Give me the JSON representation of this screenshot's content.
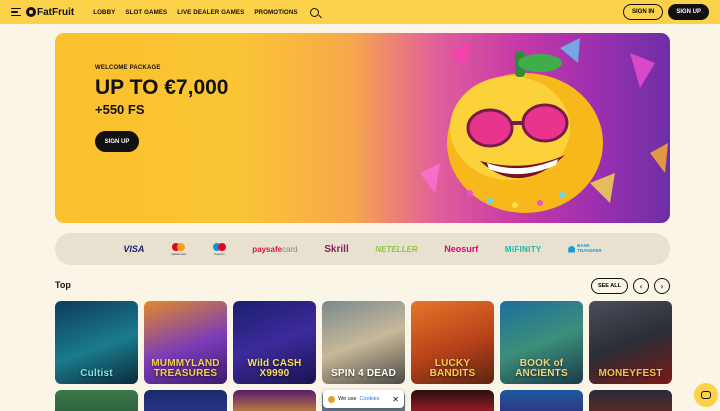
{
  "header": {
    "brand": "FatFruit",
    "nav": [
      "LOBBY",
      "SLOT GAMES",
      "LIVE DEALER GAMES",
      "PROMOTIONS"
    ],
    "sign_in": "SIGN IN",
    "sign_up": "SIGN UP"
  },
  "hero": {
    "eyebrow": "WELCOME PACKAGE",
    "title": "UP TO €7,000",
    "subtitle": "+550 FS",
    "button": "SIGN UP"
  },
  "payments": {
    "visa": "VISA",
    "mastercard": "mastercard",
    "maestro": "maestro",
    "paysafe": "paysafe",
    "paysafe_card": "card",
    "skrill": "Skrill",
    "neteller": "NETELLER",
    "neosurf": "Neosurf",
    "mifinity": "MiFINITY",
    "bank_line1": "BANK",
    "bank_line2": "TRANSFER"
  },
  "top": {
    "title": "Top",
    "see_all": "SEE ALL",
    "prev": "‹",
    "next": "›",
    "games": [
      {
        "title": "Cultist",
        "bg": "linear-gradient(160deg,#0d3b5c,#1a7b8c 55%,#0b2a3d)",
        "color": "#7be6e0"
      },
      {
        "title": "MUMMYLAND TREASURES",
        "bg": "linear-gradient(160deg,#e08a2a,#7b3cb8 55%,#3b1a6e)",
        "color": "#f7d04a"
      },
      {
        "title": "Wild CASH X9990",
        "bg": "linear-gradient(160deg,#1b1f6e,#3d2a9c 50%,#1a1450)",
        "color": "#f8e05a"
      },
      {
        "title": "SPIN 4 DEAD",
        "bg": "linear-gradient(160deg,#7a8a8c,#c7b89a 50%,#4d4a45)",
        "color": "#ffffff"
      },
      {
        "title": "LUCKY BANDITS",
        "bg": "linear-gradient(160deg,#e7752a,#b8421a 55%,#5c2410)",
        "color": "#f7d04a"
      },
      {
        "title": "BOOK of ANCIENTS",
        "bg": "linear-gradient(160deg,#1d6e9c,#3c8f7a 50%,#1c3a4c)",
        "color": "#f2d67a"
      },
      {
        "title": "MONEYFEST",
        "bg": "linear-gradient(160deg,#4a4f5a,#2a2e36 50%,#7a1a1a)",
        "color": "#f7c44a"
      }
    ]
  },
  "cookie": {
    "text": "We use",
    "link": "Cookies",
    "close": "✕"
  }
}
